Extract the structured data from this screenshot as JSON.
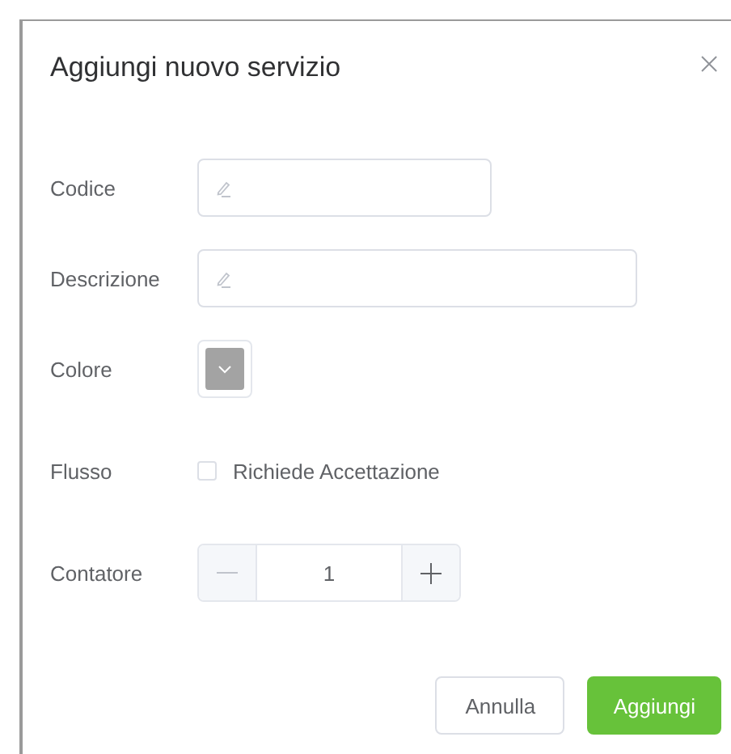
{
  "dialog": {
    "title": "Aggiungi nuovo servizio"
  },
  "fields": [
    {
      "kind": "text",
      "label": "Codice",
      "wide": false
    },
    {
      "kind": "text",
      "label": "Descrizione",
      "wide": true
    },
    {
      "kind": "color",
      "label": "Colore",
      "color": "#a3a3a3"
    },
    {
      "kind": "checkbox",
      "label": "Flusso",
      "option": "Richiede Accettazione",
      "checked": false
    },
    {
      "kind": "stepper",
      "label": "Contatore",
      "value": "1"
    }
  ],
  "buttons": [
    {
      "label": "Annulla",
      "primary": false
    },
    {
      "label": "Aggiungi",
      "primary": true
    }
  ]
}
